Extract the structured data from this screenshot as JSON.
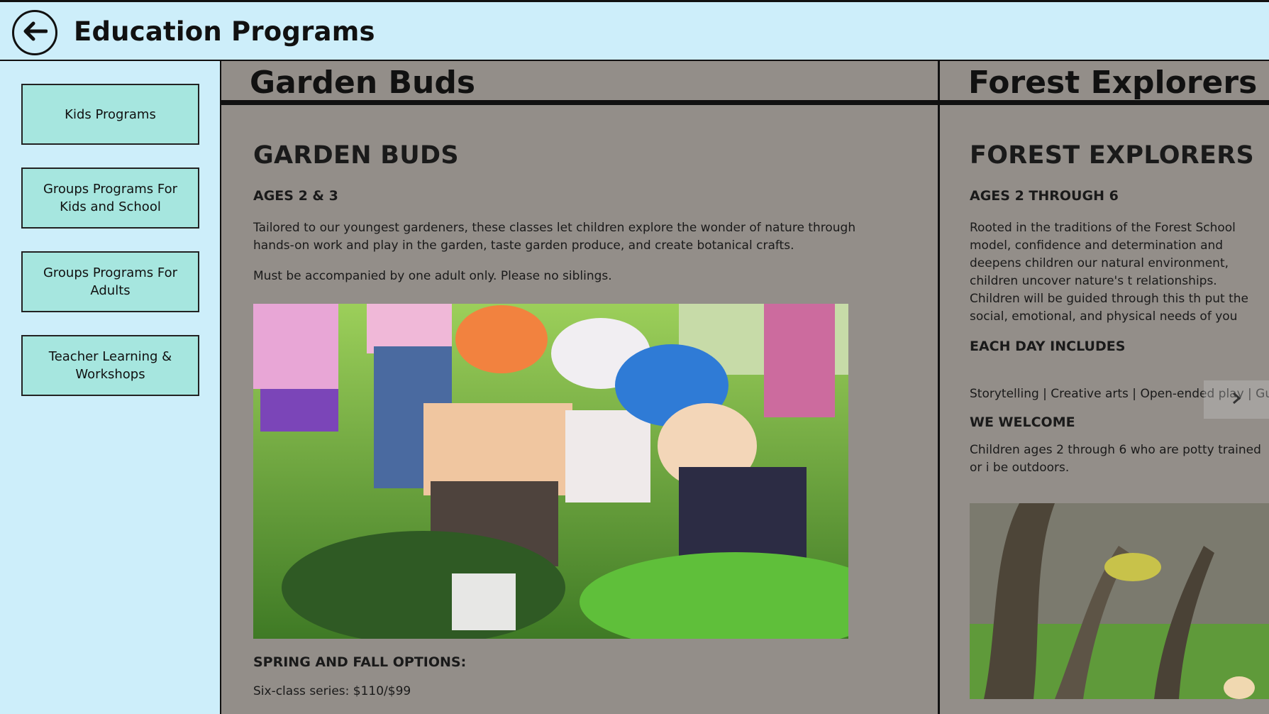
{
  "header": {
    "title": "Education Programs"
  },
  "sidebar": {
    "items": [
      {
        "label": "Kids Programs"
      },
      {
        "label": "Groups Programs For Kids and School"
      },
      {
        "label": "Groups Programs For Adults"
      },
      {
        "label": "Teacher Learning & Workshops"
      }
    ]
  },
  "panel1": {
    "header": "Garden Buds",
    "title": "GARDEN BUDS",
    "ages": "AGES 2 & 3",
    "description": "Tailored to our youngest gardeners, these classes let children explore the wonder of nature through hands-on work and play in the garden, taste garden produce, and create botanical crafts.",
    "note": "Must be accompanied by one adult only. Please no siblings.",
    "options_heading": "SPRING AND FALL OPTIONS:",
    "options_line": "Six-class series: $110/$99"
  },
  "panel2": {
    "header": "Forest Explorers",
    "title": "FOREST EXPLORERS",
    "ages": "AGES 2 THROUGH 6",
    "description": "Rooted in the traditions of the Forest School model, confidence and determination and deepens children our natural environment, children uncover nature's t relationships. Children will be guided through this th put the social, emotional, and physical needs of you",
    "each_day_heading": "EACH DAY INCLUDES",
    "each_day_text": "Storytelling | Creative arts | Open-ended play | Guide",
    "welcome_heading": "WE WELCOME",
    "welcome_text": "Children ages 2 through 6 who are potty trained or i be outdoors."
  },
  "colors": {
    "background": "#cdeefa",
    "nav_button": "#a6e6df",
    "panel": "#938e89"
  }
}
